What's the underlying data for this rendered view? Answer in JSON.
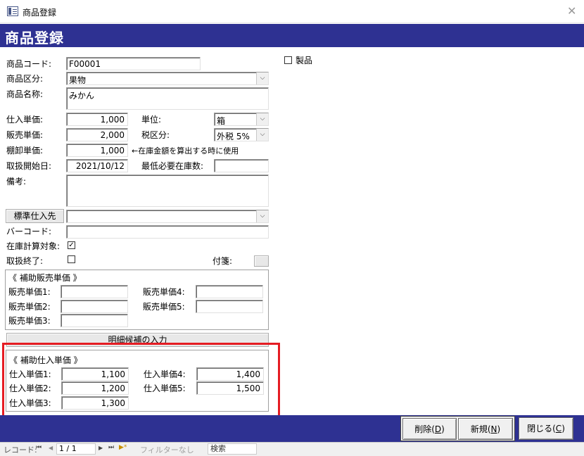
{
  "window": {
    "title": "商品登録",
    "close_glyph": "✕"
  },
  "header": {
    "title": "商品登録"
  },
  "form": {
    "product_code": {
      "label": "商品コード:",
      "value": "F00001"
    },
    "product_category": {
      "label": "商品区分:",
      "value": "果物"
    },
    "product_name": {
      "label": "商品名称:",
      "value": "みかん"
    },
    "purchase_price": {
      "label": "仕入単価:",
      "value": "1,000"
    },
    "unit": {
      "label": "単位:",
      "value": "箱"
    },
    "sales_price": {
      "label": "販売単価:",
      "value": "2,000"
    },
    "tax_category": {
      "label": "税区分:",
      "value": "外税 5%"
    },
    "inventory_price": {
      "label": "棚卸単価:",
      "value": "1,000",
      "note": "←在庫金額を算出する時に使用"
    },
    "start_date": {
      "label": "取扱開始日:",
      "value": "2021/10/12"
    },
    "min_stock": {
      "label": "最低必要在庫数:",
      "value": ""
    },
    "remarks": {
      "label": "備考:",
      "value": ""
    },
    "std_supplier": {
      "button_label": "標準仕入先",
      "value": ""
    },
    "barcode": {
      "label": "バーコード:",
      "value": ""
    },
    "stock_calc": {
      "label": "在庫計算対象:",
      "checked_glyph": "✓"
    },
    "discontinued": {
      "label": "取扱終了:"
    },
    "sticky_note": {
      "label": "付箋:"
    },
    "product_flag": {
      "label": "製品"
    },
    "combo_arrow": "⌵"
  },
  "sub_sales": {
    "title": "《 補助販売単価 》",
    "p1_label": "販売単価1:",
    "p1_value": "",
    "p2_label": "販売単価2:",
    "p2_value": "",
    "p3_label": "販売単価3:",
    "p3_value": "",
    "p4_label": "販売単価4:",
    "p4_value": "",
    "p5_label": "販売単価5:",
    "p5_value": ""
  },
  "detail_button": {
    "label": "明細候補の入力"
  },
  "sub_purchase": {
    "title": "《 補助仕入単価 》",
    "p1_label": "仕入単価1:",
    "p1_value": "1,100",
    "p2_label": "仕入単価2:",
    "p2_value": "1,200",
    "p3_label": "仕入単価3:",
    "p3_value": "1,300",
    "p4_label": "仕入単価4:",
    "p4_value": "1,400",
    "p5_label": "仕入単価5:",
    "p5_value": "1,500"
  },
  "footer": {
    "delete_text": "削除(",
    "delete_key": "D",
    "delete_end": ")",
    "new_text": "新規(",
    "new_key": "N",
    "new_end": ")",
    "close_text": "閉じる(",
    "close_key": "C",
    "close_end": ")"
  },
  "status": {
    "record_label": "レコード:",
    "first": "⏮",
    "prev": "◀",
    "position": "1 / 1",
    "next": "▶",
    "last": "⏭",
    "new_rec": "▶*",
    "filter": "フィルターなし",
    "search": "検索"
  },
  "colors": {
    "header_bg": "#2e3192",
    "highlight": "#e51c23"
  }
}
